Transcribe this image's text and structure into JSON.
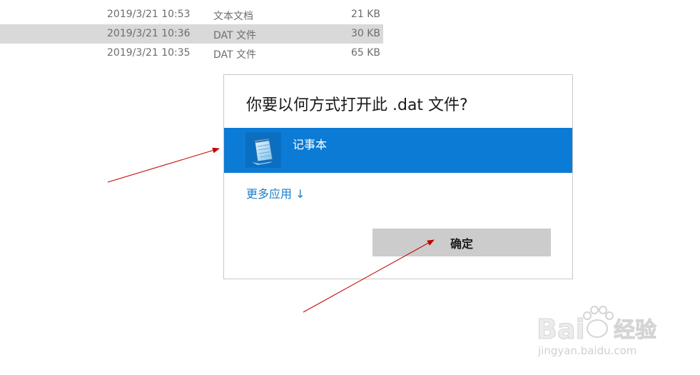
{
  "file_list": {
    "rows": [
      {
        "date": "2019/3/21 10:53",
        "type": "文本文档",
        "size": "21 KB",
        "selected": false
      },
      {
        "date": "2019/3/21 10:36",
        "type": "DAT 文件",
        "size": "30 KB",
        "selected": true
      },
      {
        "date": "2019/3/21 10:35",
        "type": "DAT 文件",
        "size": "65 KB",
        "selected": false
      }
    ]
  },
  "dialog": {
    "title": "你要以何方式打开此 .dat 文件?",
    "app": {
      "label": "记事本",
      "icon": "notepad-icon"
    },
    "more_apps_label": "更多应用 ↓",
    "ok_label": "确定"
  },
  "annotations": {
    "arrow_color": "#c00000"
  },
  "watermark": {
    "brand": "Bai du 经验",
    "url": "jingyan.baidu.com"
  },
  "colors": {
    "accent": "#0c7bd6",
    "link": "#1a7fc7",
    "selected_row": "#d9d9d9",
    "button": "#cccccc"
  }
}
